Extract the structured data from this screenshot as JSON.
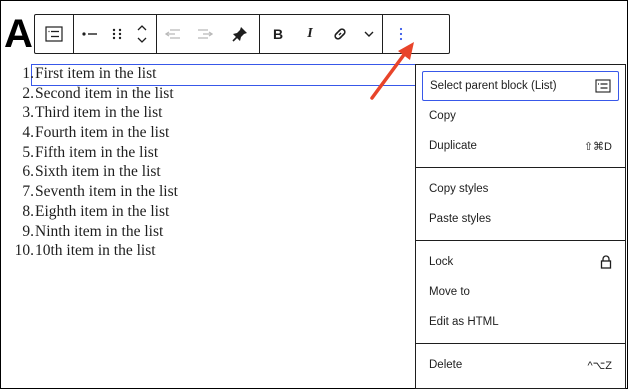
{
  "heading": {
    "text": "A"
  },
  "toolbar": {
    "parent_icon": "list-parent-icon",
    "style_icon": "bullet-list-icon",
    "drag_icon": "drag-handle-icon",
    "move_icon": "move-up-down-icon",
    "outdent_icon": "outdent-icon",
    "indent_icon": "indent-icon",
    "highlight_icon": "pin-icon",
    "bold_label": "B",
    "italic_label": "I",
    "link_icon": "link-icon",
    "more_rich_icon": "chevron-down-icon",
    "options_icon": "vertical-ellipsis-icon"
  },
  "list": {
    "items": [
      {
        "num": "1.",
        "text": "First item in the list"
      },
      {
        "num": "2.",
        "text": "Second item in the list"
      },
      {
        "num": "3.",
        "text": "Third item in the list"
      },
      {
        "num": "4.",
        "text": "Fourth item in the list"
      },
      {
        "num": "5.",
        "text": "Fifth item in the list"
      },
      {
        "num": "6.",
        "text": "Sixth item in the list"
      },
      {
        "num": "7.",
        "text": "Seventh item in the list"
      },
      {
        "num": "8.",
        "text": "Eighth item in the list"
      },
      {
        "num": "9.",
        "text": "Ninth item in the list"
      },
      {
        "num": "10.",
        "text": "10th item in the list"
      }
    ]
  },
  "menu": {
    "select_parent": "Select parent block (List)",
    "copy": "Copy",
    "duplicate": "Duplicate",
    "duplicate_shortcut": "⇧⌘D",
    "copy_styles": "Copy styles",
    "paste_styles": "Paste styles",
    "lock": "Lock",
    "move_to": "Move to",
    "edit_html": "Edit as HTML",
    "delete": "Delete",
    "delete_shortcut": "^⌥Z"
  },
  "colors": {
    "accent": "#3858e9",
    "arrow": "#e8442a"
  }
}
